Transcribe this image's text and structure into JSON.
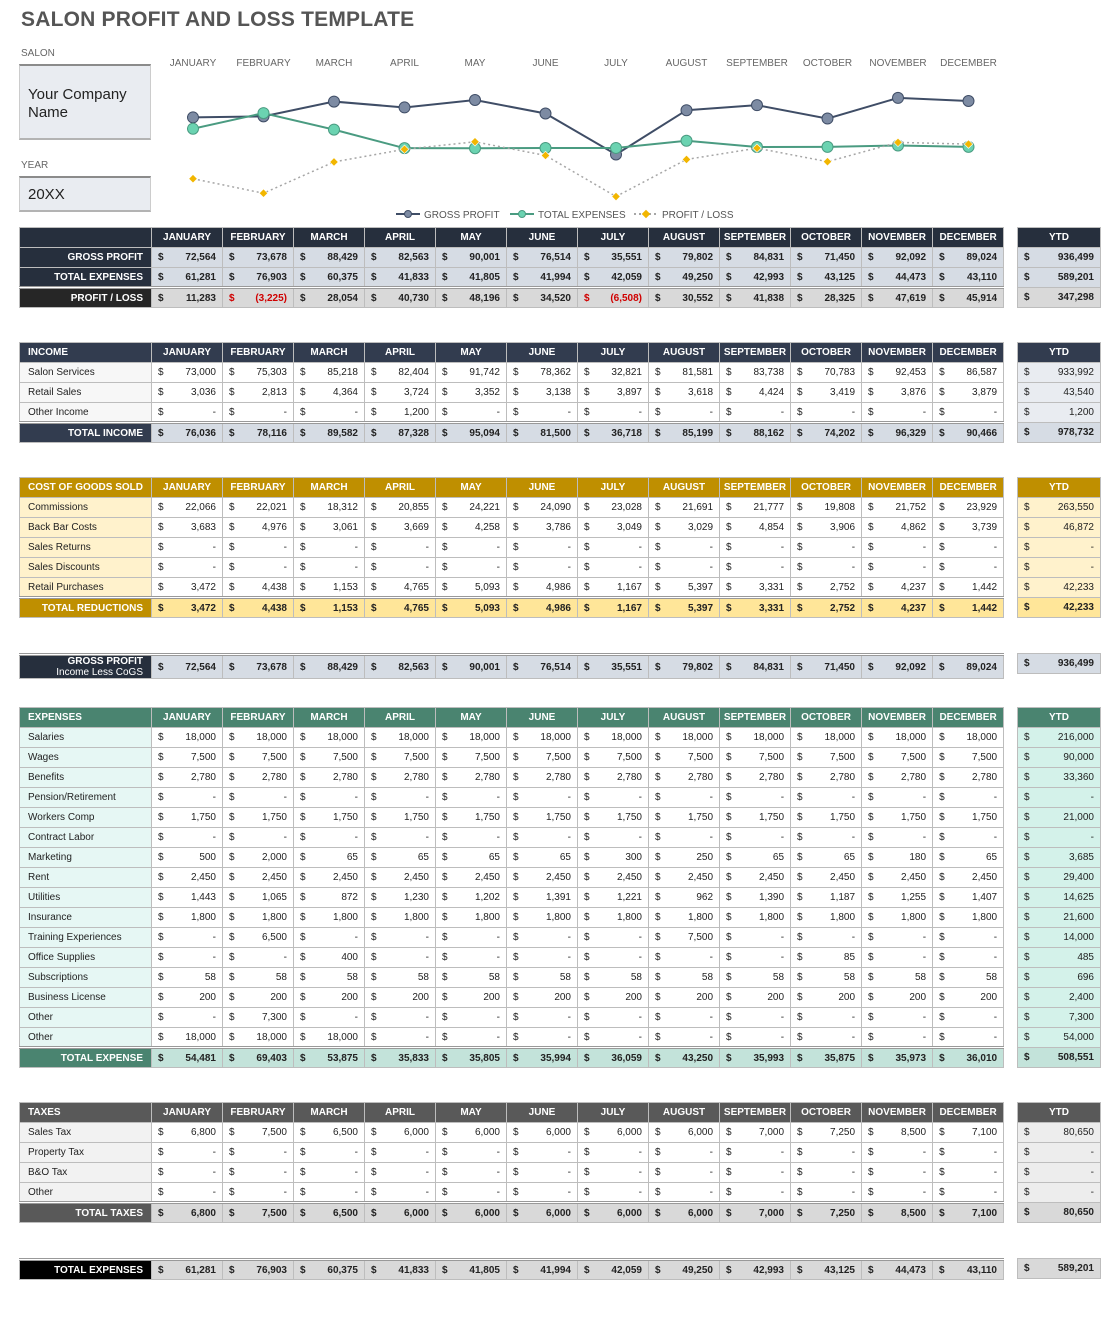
{
  "title": "SALON PROFIT AND LOSS TEMPLATE",
  "salon": {
    "label": "SALON",
    "value": "Your Company Name"
  },
  "year": {
    "label": "YEAR",
    "value": "20XX"
  },
  "months": [
    "JANUARY",
    "FEBRUARY",
    "MARCH",
    "APRIL",
    "MAY",
    "JUNE",
    "JULY",
    "AUGUST",
    "SEPTEMBER",
    "OCTOBER",
    "NOVEMBER",
    "DECEMBER"
  ],
  "ytd_label": "YTD",
  "colors": {
    "navy": "#262f3d",
    "income_head": "#323c4f",
    "cogs_head": "#bf8f00",
    "expense_head": "#4a8470",
    "tax_head": "#595959",
    "black": "#000000",
    "negative": "#d00000"
  },
  "chart_data": {
    "type": "line",
    "categories": [
      "JANUARY",
      "FEBRUARY",
      "MARCH",
      "APRIL",
      "MAY",
      "JUNE",
      "JULY",
      "AUGUST",
      "SEPTEMBER",
      "OCTOBER",
      "NOVEMBER",
      "DECEMBER"
    ],
    "series": [
      {
        "name": "GROSS PROFIT",
        "values": [
          72564,
          73678,
          88429,
          82563,
          90001,
          76514,
          35551,
          79802,
          84831,
          71450,
          92092,
          89024
        ],
        "color": "#3f4d66",
        "marker": "#7d8ba3"
      },
      {
        "name": "TOTAL EXPENSES",
        "values": [
          61281,
          76903,
          60375,
          41833,
          41805,
          41994,
          42059,
          49250,
          42993,
          43125,
          44473,
          43110
        ],
        "color": "#4a9b81",
        "marker": "#6bd3b1"
      },
      {
        "name": "PROFIT / LOSS",
        "values": [
          11283,
          -3225,
          28054,
          40730,
          48196,
          34520,
          -6508,
          30552,
          41838,
          28325,
          47619,
          45914
        ],
        "color": "#a6a6a6",
        "marker": "#f2b600",
        "dashed": true
      }
    ],
    "legend": [
      "GROSS PROFIT",
      "TOTAL EXPENSES",
      "PROFIT / LOSS"
    ],
    "legend_position": "bottom",
    "grid": false
  },
  "summary": {
    "rows": [
      {
        "label": "GROSS PROFIT",
        "values": [
          "72,564",
          "73,678",
          "88,429",
          "82,563",
          "90,001",
          "76,514",
          "35,551",
          "79,802",
          "84,831",
          "71,450",
          "92,092",
          "89,024"
        ],
        "ytd": "936,499"
      },
      {
        "label": "TOTAL EXPENSES",
        "values": [
          "61,281",
          "76,903",
          "60,375",
          "41,833",
          "41,805",
          "41,994",
          "42,059",
          "49,250",
          "42,993",
          "43,125",
          "44,473",
          "43,110"
        ],
        "ytd": "589,201"
      }
    ],
    "total": {
      "label": "PROFIT / LOSS",
      "values": [
        "11,283",
        "(3,225)",
        "28,054",
        "40,730",
        "48,196",
        "34,520",
        "(6,508)",
        "30,552",
        "41,838",
        "28,325",
        "47,619",
        "45,914"
      ],
      "ytd": "347,298",
      "negatives": [
        1,
        6
      ]
    }
  },
  "income": {
    "header": "INCOME",
    "rows": [
      {
        "label": "Salon Services",
        "values": [
          "73,000",
          "75,303",
          "85,218",
          "82,404",
          "91,742",
          "78,362",
          "32,821",
          "81,581",
          "83,738",
          "70,783",
          "92,453",
          "86,587"
        ],
        "ytd": "933,992"
      },
      {
        "label": "Retail Sales",
        "values": [
          "3,036",
          "2,813",
          "4,364",
          "3,724",
          "3,352",
          "3,138",
          "3,897",
          "3,618",
          "4,424",
          "3,419",
          "3,876",
          "3,879"
        ],
        "ytd": "43,540"
      },
      {
        "label": "Other Income",
        "values": [
          "-",
          "-",
          "-",
          "1,200",
          "-",
          "-",
          "-",
          "-",
          "-",
          "-",
          "-",
          "-"
        ],
        "ytd": "1,200"
      }
    ],
    "total": {
      "label": "TOTAL INCOME",
      "values": [
        "76,036",
        "78,116",
        "89,582",
        "87,328",
        "95,094",
        "81,500",
        "36,718",
        "85,199",
        "88,162",
        "74,202",
        "96,329",
        "90,466"
      ],
      "ytd": "978,732"
    }
  },
  "cogs": {
    "header": "COST OF GOODS SOLD",
    "rows": [
      {
        "label": "Commissions",
        "values": [
          "22,066",
          "22,021",
          "18,312",
          "20,855",
          "24,221",
          "24,090",
          "23,028",
          "21,691",
          "21,777",
          "19,808",
          "21,752",
          "23,929"
        ],
        "ytd": "263,550"
      },
      {
        "label": "Back Bar Costs",
        "values": [
          "3,683",
          "4,976",
          "3,061",
          "3,669",
          "4,258",
          "3,786",
          "3,049",
          "3,029",
          "4,854",
          "3,906",
          "4,862",
          "3,739"
        ],
        "ytd": "46,872"
      },
      {
        "label": "Sales Returns",
        "values": [
          "-",
          "-",
          "-",
          "-",
          "-",
          "-",
          "-",
          "-",
          "-",
          "-",
          "-",
          "-"
        ],
        "ytd": "-"
      },
      {
        "label": "Sales Discounts",
        "values": [
          "-",
          "-",
          "-",
          "-",
          "-",
          "-",
          "-",
          "-",
          "-",
          "-",
          "-",
          "-"
        ],
        "ytd": "-"
      },
      {
        "label": "Retail Purchases",
        "values": [
          "3,472",
          "4,438",
          "1,153",
          "4,765",
          "5,093",
          "4,986",
          "1,167",
          "5,397",
          "3,331",
          "2,752",
          "4,237",
          "1,442"
        ],
        "ytd": "42,233"
      }
    ],
    "total": {
      "label": "TOTAL REDUCTIONS",
      "values": [
        "3,472",
        "4,438",
        "1,153",
        "4,765",
        "5,093",
        "4,986",
        "1,167",
        "5,397",
        "3,331",
        "2,752",
        "4,237",
        "1,442"
      ],
      "ytd": "42,233"
    }
  },
  "gross": {
    "label": "GROSS PROFIT",
    "sublabel": "Income Less CoGS",
    "values": [
      "72,564",
      "73,678",
      "88,429",
      "82,563",
      "90,001",
      "76,514",
      "35,551",
      "79,802",
      "84,831",
      "71,450",
      "92,092",
      "89,024"
    ],
    "ytd": "936,499"
  },
  "expenses": {
    "header": "EXPENSES",
    "rows": [
      {
        "label": "Salaries",
        "values": [
          "18,000",
          "18,000",
          "18,000",
          "18,000",
          "18,000",
          "18,000",
          "18,000",
          "18,000",
          "18,000",
          "18,000",
          "18,000",
          "18,000"
        ],
        "ytd": "216,000"
      },
      {
        "label": "Wages",
        "values": [
          "7,500",
          "7,500",
          "7,500",
          "7,500",
          "7,500",
          "7,500",
          "7,500",
          "7,500",
          "7,500",
          "7,500",
          "7,500",
          "7,500"
        ],
        "ytd": "90,000"
      },
      {
        "label": "Benefits",
        "values": [
          "2,780",
          "2,780",
          "2,780",
          "2,780",
          "2,780",
          "2,780",
          "2,780",
          "2,780",
          "2,780",
          "2,780",
          "2,780",
          "2,780"
        ],
        "ytd": "33,360"
      },
      {
        "label": "Pension/Retirement",
        "values": [
          "-",
          "-",
          "-",
          "-",
          "-",
          "-",
          "-",
          "-",
          "-",
          "-",
          "-",
          "-"
        ],
        "ytd": "-"
      },
      {
        "label": "Workers Comp",
        "values": [
          "1,750",
          "1,750",
          "1,750",
          "1,750",
          "1,750",
          "1,750",
          "1,750",
          "1,750",
          "1,750",
          "1,750",
          "1,750",
          "1,750"
        ],
        "ytd": "21,000"
      },
      {
        "label": "Contract Labor",
        "values": [
          "-",
          "-",
          "-",
          "-",
          "-",
          "-",
          "-",
          "-",
          "-",
          "-",
          "-",
          "-"
        ],
        "ytd": "-"
      },
      {
        "label": "Marketing",
        "values": [
          "500",
          "2,000",
          "65",
          "65",
          "65",
          "65",
          "300",
          "250",
          "65",
          "65",
          "180",
          "65"
        ],
        "ytd": "3,685"
      },
      {
        "label": "Rent",
        "values": [
          "2,450",
          "2,450",
          "2,450",
          "2,450",
          "2,450",
          "2,450",
          "2,450",
          "2,450",
          "2,450",
          "2,450",
          "2,450",
          "2,450"
        ],
        "ytd": "29,400"
      },
      {
        "label": "Utilities",
        "values": [
          "1,443",
          "1,065",
          "872",
          "1,230",
          "1,202",
          "1,391",
          "1,221",
          "962",
          "1,390",
          "1,187",
          "1,255",
          "1,407"
        ],
        "ytd": "14,625"
      },
      {
        "label": "Insurance",
        "values": [
          "1,800",
          "1,800",
          "1,800",
          "1,800",
          "1,800",
          "1,800",
          "1,800",
          "1,800",
          "1,800",
          "1,800",
          "1,800",
          "1,800"
        ],
        "ytd": "21,600"
      },
      {
        "label": "Training Experiences",
        "values": [
          "-",
          "6,500",
          "-",
          "-",
          "-",
          "-",
          "-",
          "7,500",
          "-",
          "-",
          "-",
          "-"
        ],
        "ytd": "14,000"
      },
      {
        "label": "Office Supplies",
        "values": [
          "-",
          "-",
          "400",
          "-",
          "-",
          "-",
          "-",
          "-",
          "-",
          "85",
          "-",
          "-"
        ],
        "ytd": "485"
      },
      {
        "label": "Subscriptions",
        "values": [
          "58",
          "58",
          "58",
          "58",
          "58",
          "58",
          "58",
          "58",
          "58",
          "58",
          "58",
          "58"
        ],
        "ytd": "696"
      },
      {
        "label": "Business License",
        "values": [
          "200",
          "200",
          "200",
          "200",
          "200",
          "200",
          "200",
          "200",
          "200",
          "200",
          "200",
          "200"
        ],
        "ytd": "2,400"
      },
      {
        "label": "Other",
        "values": [
          "-",
          "7,300",
          "-",
          "-",
          "-",
          "-",
          "-",
          "-",
          "-",
          "-",
          "-",
          "-"
        ],
        "ytd": "7,300"
      },
      {
        "label": "Other",
        "values": [
          "18,000",
          "18,000",
          "18,000",
          "-",
          "-",
          "-",
          "-",
          "-",
          "-",
          "-",
          "-",
          "-"
        ],
        "ytd": "54,000"
      }
    ],
    "total": {
      "label": "TOTAL EXPENSE",
      "values": [
        "54,481",
        "69,403",
        "53,875",
        "35,833",
        "35,805",
        "35,994",
        "36,059",
        "43,250",
        "35,993",
        "35,875",
        "35,973",
        "36,010"
      ],
      "ytd": "508,551"
    }
  },
  "taxes": {
    "header": "TAXES",
    "rows": [
      {
        "label": "Sales Tax",
        "values": [
          "6,800",
          "7,500",
          "6,500",
          "6,000",
          "6,000",
          "6,000",
          "6,000",
          "6,000",
          "7,000",
          "7,250",
          "8,500",
          "7,100"
        ],
        "ytd": "80,650"
      },
      {
        "label": "Property Tax",
        "values": [
          "-",
          "-",
          "-",
          "-",
          "-",
          "-",
          "-",
          "-",
          "-",
          "-",
          "-",
          "-"
        ],
        "ytd": "-"
      },
      {
        "label": "B&O Tax",
        "values": [
          "-",
          "-",
          "-",
          "-",
          "-",
          "-",
          "-",
          "-",
          "-",
          "-",
          "-",
          "-"
        ],
        "ytd": "-"
      },
      {
        "label": "Other",
        "values": [
          "-",
          "-",
          "-",
          "-",
          "-",
          "-",
          "-",
          "-",
          "-",
          "-",
          "-",
          "-"
        ],
        "ytd": "-"
      }
    ],
    "total": {
      "label": "TOTAL TAXES",
      "values": [
        "6,800",
        "7,500",
        "6,500",
        "6,000",
        "6,000",
        "6,000",
        "6,000",
        "6,000",
        "7,000",
        "7,250",
        "8,500",
        "7,100"
      ],
      "ytd": "80,650"
    }
  },
  "grand_total": {
    "label": "TOTAL EXPENSES",
    "values": [
      "61,281",
      "76,903",
      "60,375",
      "41,833",
      "41,805",
      "41,994",
      "42,059",
      "49,250",
      "42,993",
      "43,125",
      "44,473",
      "43,110"
    ],
    "ytd": "589,201"
  }
}
